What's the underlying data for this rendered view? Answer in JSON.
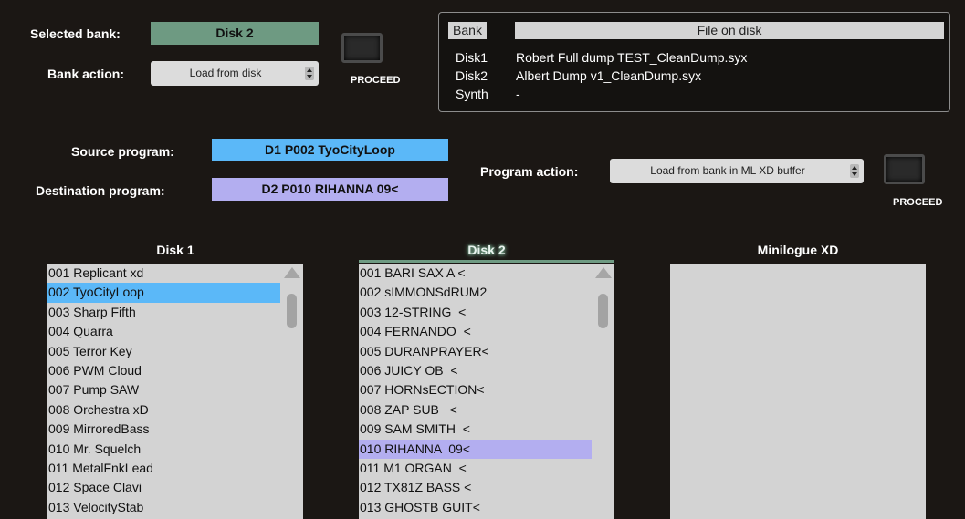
{
  "bank": {
    "selected_label": "Selected bank:",
    "selected_value": "Disk 2",
    "action_label": "Bank action:",
    "action_value": "Load from disk",
    "proceed_label": "PROCEED"
  },
  "info": {
    "headers": [
      "Bank",
      "File on disk"
    ],
    "rows": [
      {
        "bank": "Disk1",
        "file": "Robert Full dump TEST_CleanDump.syx"
      },
      {
        "bank": "Disk2",
        "file": "Albert Dump v1_CleanDump.syx"
      },
      {
        "bank": "Synth",
        "file": "-"
      }
    ]
  },
  "program": {
    "source_label": "Source program:",
    "source_value": "D1 P002 TyoCityLoop",
    "dest_label": "Destination program:",
    "dest_value": "D2 P010 RIHANNA  09<",
    "action_label": "Program action:",
    "action_value": "Load from bank in ML XD buffer",
    "proceed_label": "PROCEED"
  },
  "columns": {
    "disk1_title": "Disk 1",
    "disk2_title": "Disk 2",
    "synth_title": "Minilogue XD"
  },
  "disk1": {
    "selected_index": 1,
    "items": [
      "001 Replicant xd",
      "002 TyoCityLoop",
      "003 Sharp Fifth",
      "004 Quarra",
      "005 Terror Key",
      "006 PWM Cloud",
      "007 Pump SAW",
      "008 Orchestra xD",
      "009 MirroredBass",
      "010 Mr. Squelch",
      "011 MetalFnkLead",
      "012 Space Clavi",
      "013 VelocityStab"
    ]
  },
  "disk2": {
    "selected_index": 9,
    "items": [
      "001 BARI SAX A <",
      "002 sIMMONSdRUM2",
      "003 12-STRING  <",
      "004 FERNANDO  <",
      "005 DURANPRAYER<",
      "006 JUICY OB  <",
      "007 HORNsECTION<",
      "008 ZAP SUB   <",
      "009 SAM SMITH  <",
      "010 RIHANNA  09<",
      "011 M1 ORGAN  <",
      "012 TX81Z BASS <",
      "013 GHOSTB GUIT<"
    ]
  },
  "colors": {
    "background": "#1b1714",
    "bank_field": "#6e9a82",
    "source_highlight": "#5bb8f8",
    "dest_highlight": "#b3aef0",
    "list_bg": "#d3d3d3"
  }
}
